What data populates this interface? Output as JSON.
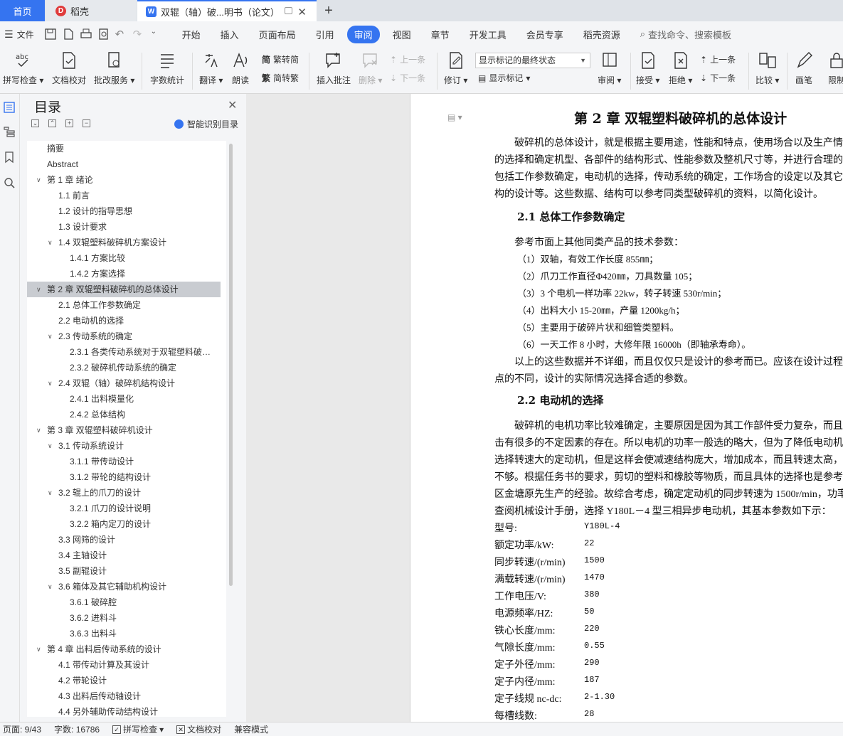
{
  "tabs": {
    "home": "首页",
    "daoke": "稻壳",
    "doc": "双辊（轴）破...明书（论文）"
  },
  "menu": {
    "file": "文件",
    "items": [
      "开始",
      "插入",
      "页面布局",
      "引用",
      "审阅",
      "视图",
      "章节",
      "开发工具",
      "会员专享",
      "稻壳资源"
    ],
    "active": "审阅",
    "search": "查找命令、搜索模板"
  },
  "ribbon": {
    "spellcheck": "拼写检查",
    "doc_proof": "文档校对",
    "grading": "批改服务",
    "word_count": "字数统计",
    "translate": "翻译",
    "read_aloud": "朗读",
    "trad_convert": "繁转简",
    "simp_convert": "简转繁",
    "insert_comment": "插入批注",
    "delete": "删除",
    "prev_comment": "上一条",
    "next_comment": "下一条",
    "track_changes": "修订",
    "markup_select": "显示标记的最终状态",
    "show_markup": "显示标记",
    "review_pane": "审阅",
    "accept": "接受",
    "reject": "拒绝",
    "prev_change": "上一条",
    "next_change": "下一条",
    "compare": "比较",
    "ink": "画笔",
    "restrict": "限制"
  },
  "toc": {
    "title": "目录",
    "smart": "智能识别目录",
    "items": [
      {
        "text": "摘要",
        "level": 0,
        "chev": false
      },
      {
        "text": "Abstract",
        "level": 0,
        "chev": false
      },
      {
        "text": "第 1 章  绪论",
        "level": 0,
        "chev": true
      },
      {
        "text": "1.1 前言",
        "level": 1,
        "chev": false
      },
      {
        "text": "1.2 设计的指导思想",
        "level": 1,
        "chev": false
      },
      {
        "text": "1.3  设计要求",
        "level": 1,
        "chev": false
      },
      {
        "text": "1.4 双辊塑料破碎机方案设计",
        "level": 1,
        "chev": true
      },
      {
        "text": "1.4.1 方案比较",
        "level": 2,
        "chev": false
      },
      {
        "text": "1.4.2 方案选择",
        "level": 2,
        "chev": false
      },
      {
        "text": "第 2 章  双辊塑料破碎机的总体设计",
        "level": 0,
        "chev": true,
        "selected": true
      },
      {
        "text": "2.1 总体工作参数确定",
        "level": 1,
        "chev": false
      },
      {
        "text": "2.2 电动机的选择",
        "level": 1,
        "chev": false
      },
      {
        "text": "2.3 传动系统的确定",
        "level": 1,
        "chev": true
      },
      {
        "text": "2.3.1 各类传动系统对于双辊塑料破碎机的影响",
        "level": 2,
        "chev": false
      },
      {
        "text": "2.3.2 破碎机传动系统的确定",
        "level": 2,
        "chev": false
      },
      {
        "text": "2.4 双辊（轴）破碎机结构设计",
        "level": 1,
        "chev": true
      },
      {
        "text": "2.4.1 出料模量化",
        "level": 2,
        "chev": false
      },
      {
        "text": "2.4.2 总体结构",
        "level": 2,
        "chev": false
      },
      {
        "text": "第 3 章  双辊塑料破碎机设计",
        "level": 0,
        "chev": true
      },
      {
        "text": "3.1 传动系统设计",
        "level": 1,
        "chev": true
      },
      {
        "text": "3.1.1 带传动设计",
        "level": 2,
        "chev": false
      },
      {
        "text": "3.1.2 带轮的结构设计",
        "level": 2,
        "chev": false
      },
      {
        "text": "3.2 辊上的爪刀的设计",
        "level": 1,
        "chev": true
      },
      {
        "text": "3.2.1 爪刀的设计说明",
        "level": 2,
        "chev": false
      },
      {
        "text": "3.2.2 箱内定刀的设计",
        "level": 2,
        "chev": false
      },
      {
        "text": "3.3 网筛的设计",
        "level": 1,
        "chev": false
      },
      {
        "text": "3.4 主轴设计",
        "level": 1,
        "chev": false
      },
      {
        "text": "3.5 副辊设计",
        "level": 1,
        "chev": false
      },
      {
        "text": "3.6 箱体及其它辅助机构设计",
        "level": 1,
        "chev": true
      },
      {
        "text": "3.6.1  破碎腔",
        "level": 2,
        "chev": false
      },
      {
        "text": "3.6.2  进料斗",
        "level": 2,
        "chev": false
      },
      {
        "text": "3.6.3  出料斗",
        "level": 2,
        "chev": false
      },
      {
        "text": "第 4 章  出料后传动系统的设计",
        "level": 0,
        "chev": true
      },
      {
        "text": "4.1  带传动计算及其设计",
        "level": 1,
        "chev": false
      },
      {
        "text": "4.2  带轮设计",
        "level": 1,
        "chev": false
      },
      {
        "text": "4.3 出料后传动轴设计",
        "level": 1,
        "chev": false
      },
      {
        "text": "4.4 另外辅助传动结构设计",
        "level": 1,
        "chev": false
      }
    ]
  },
  "document": {
    "title": "第 2 章  双辊塑料破碎机的总体设计",
    "p1": [
      "破碎机的总体设计，就是根据主要用途，性能和特点，使用场合以及生产情况",
      "的选择和确定机型、各部件的结构形式、性能参数及整机尺寸等，并进行合理的布",
      "包括工作参数确定，电动机的选择，传动系统的确定，工作场合的设定以及其它一",
      "构的设计等。这些数据、结构可以参考同类型破碎机的资料，以简化设计。"
    ],
    "h21": "2.1 总体工作参数确定",
    "ref": "参考市面上其他同类产品的技术参数：",
    "list": [
      "（1）双轴，有效工作长度 855㎜；",
      "（2）爪刀工作直径Φ420㎜，刀具数量 105；",
      "（3）3 个电机一样功率 22kw，转子转速 530r/min；",
      "（4）出料大小 15-20㎜，产量 1200kg/h；",
      "（5）主要用于破碎片状和细管类塑料。",
      "（6）一天工作 8 小时，大修年限 16000h（即轴承寿命）。"
    ],
    "p2": [
      "以上的这些数据并不详细，而且仅仅只是设计的参考而已。应该在设计过程中",
      "点的不同，设计的实际情况选择合适的参数。"
    ],
    "h22": "2.2 电动机的选择",
    "p3": [
      "破碎机的电机功率比较难确定，主要原因是因为其工作部件受力复杂，而且有",
      "击有很多的不定因素的存在。所以电机的功率一般选的略大，但为了降低电动机的",
      "选择转速大的定动机，但是这样会使减速结构庞大，增加成本，而且转速太高，会",
      "不够。根据任务书的要求，剪切的塑料和橡胶等物质，而且具体的选择也是参考了",
      "区金塘原先生产的经验。故综合考虑，确定定动机的同步转速为 1500r/min，功率",
      "查阅机械设计手册，选择 Y180L－4 型三相异步电动机，其基本参数如下示："
    ],
    "specs": [
      {
        "k": "型号:",
        "v": "Y180L-4"
      },
      {
        "k": "额定功率/kW:",
        "v": "22"
      },
      {
        "k": "同步转速/(r/min)",
        "v": "1500"
      },
      {
        "k": "满载转速/(r/min)",
        "v": "1470"
      },
      {
        "k": "工作电压/V:",
        "v": "380"
      },
      {
        "k": "电源频率/HZ:",
        "v": "50"
      },
      {
        "k": "铁心长度/mm:",
        "v": "220"
      },
      {
        "k": "气隙长度/mm:",
        "v": "0.55"
      },
      {
        "k": "定子外径/mm:",
        "v": "290"
      },
      {
        "k": "定子内径/mm:",
        "v": "187"
      },
      {
        "k": "定子线规 nc-dc:",
        "v": "2-1.30"
      },
      {
        "k": "每槽线数:",
        "v": "28"
      }
    ]
  },
  "status": {
    "page": "页面: 9/43",
    "words": "字数: 16786",
    "spell": "拼写检查",
    "proof": "文档校对",
    "compat": "兼容模式"
  }
}
